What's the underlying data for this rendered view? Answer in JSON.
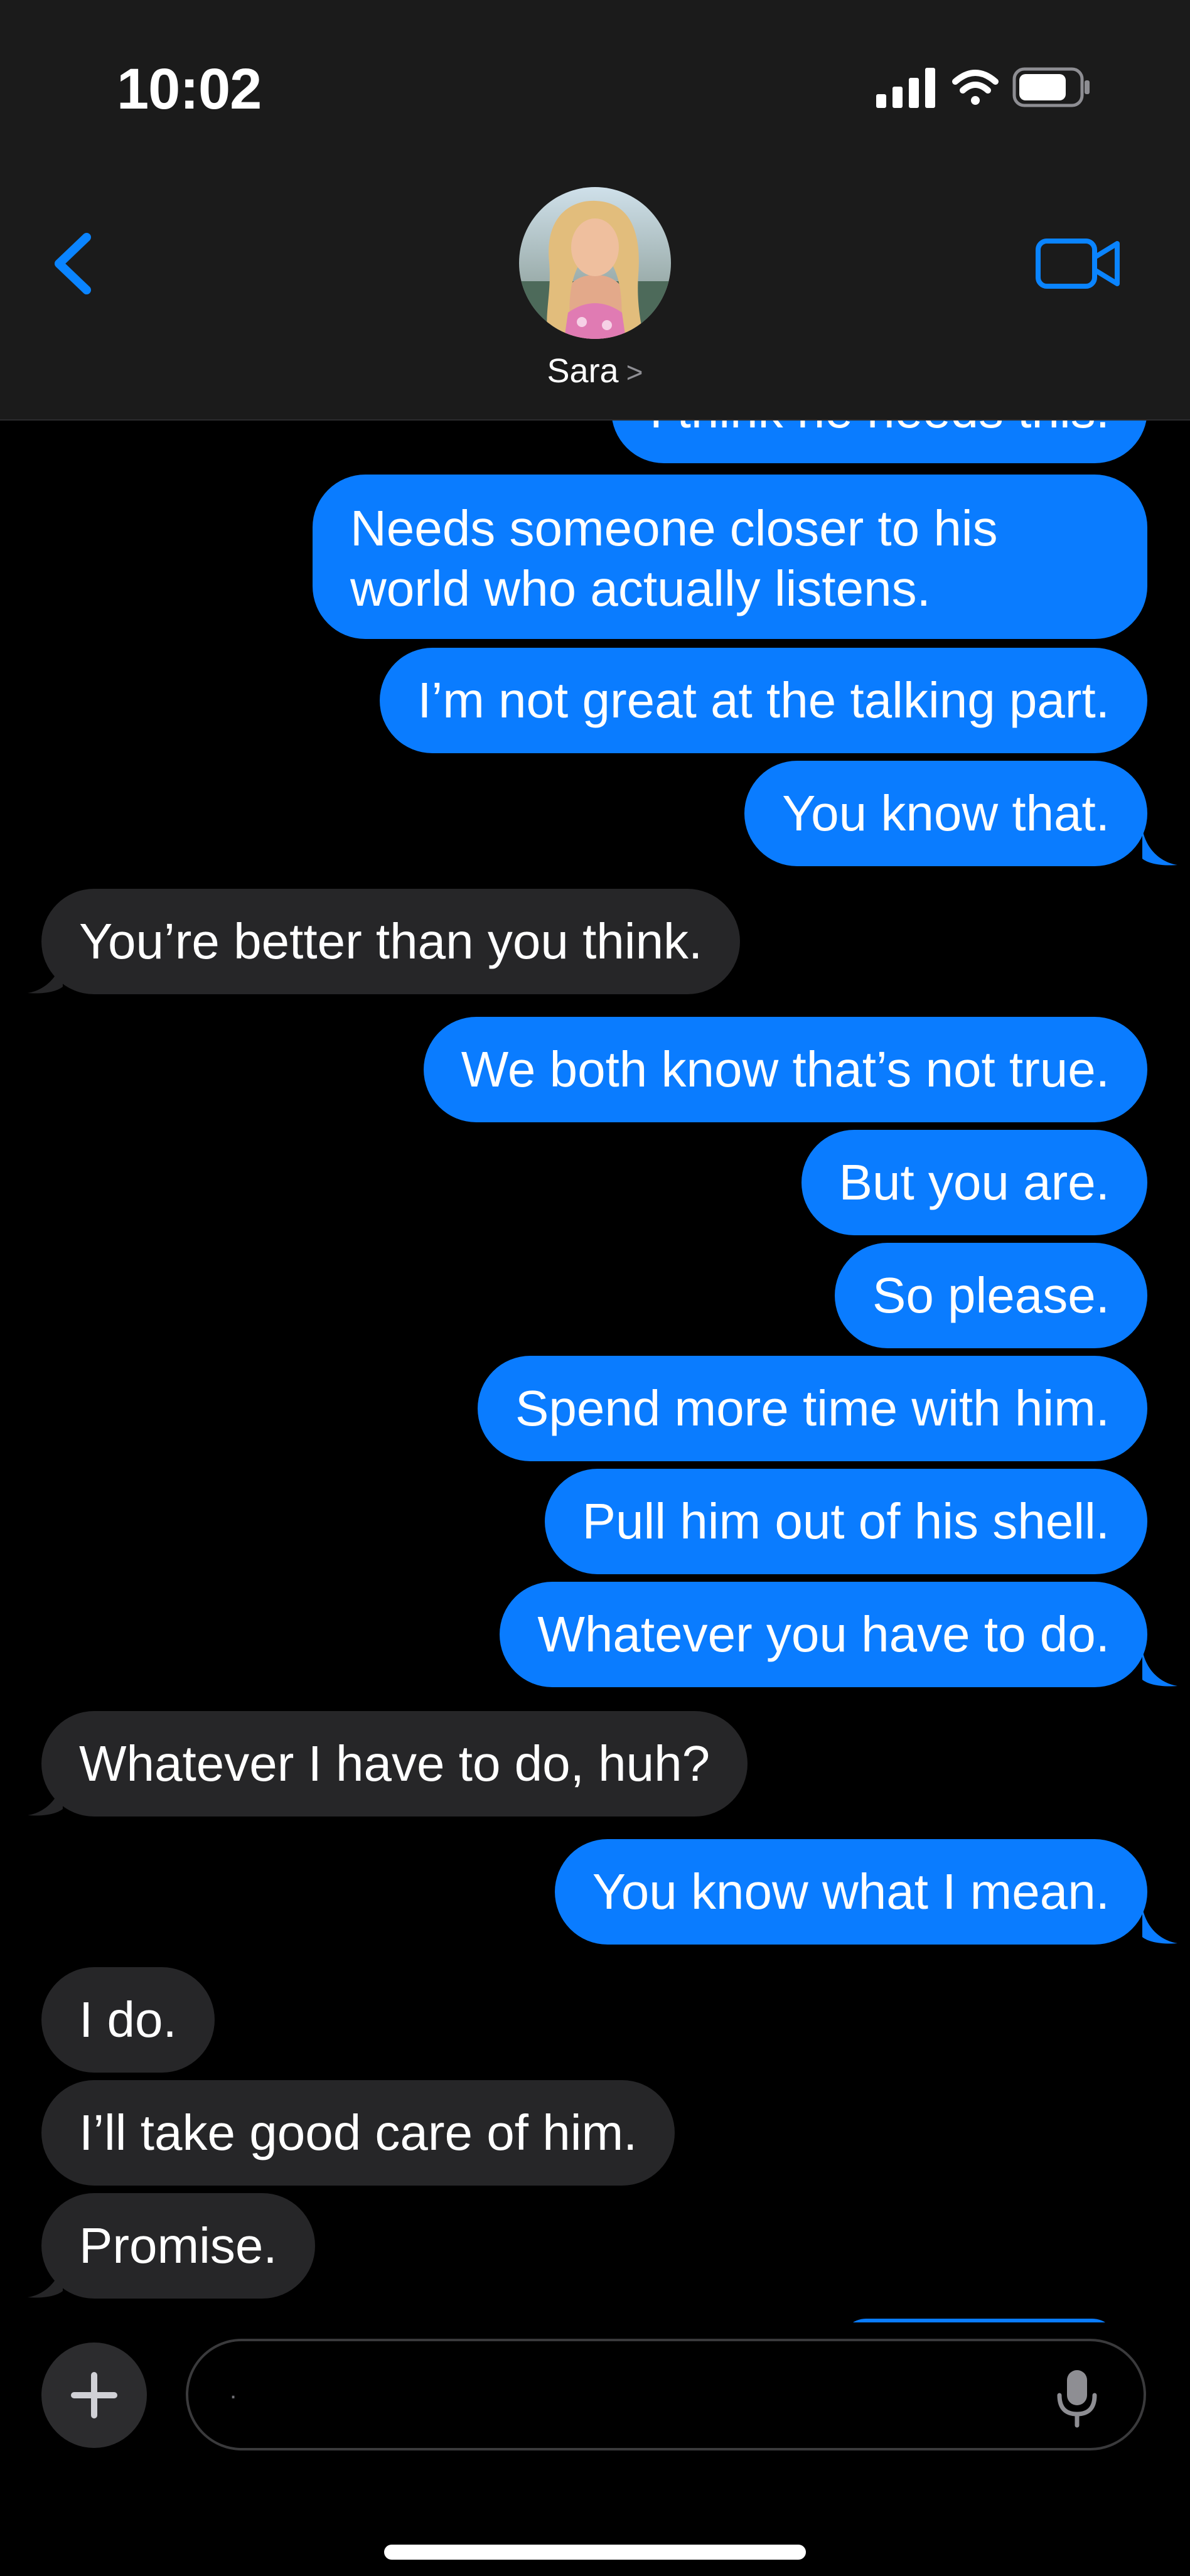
{
  "status_bar": {
    "time": "10:02",
    "signal_icon": "cellular-signal-icon",
    "wifi_icon": "wifi-icon",
    "battery_icon": "battery-icon"
  },
  "header": {
    "back_icon": "chevron-left-icon",
    "video_icon": "video-camera-icon",
    "contact_name": "Sara",
    "contact_chevron": ">"
  },
  "colors": {
    "sent_bubble": "#0a7cff",
    "received_bubble": "#262628",
    "header_bg": "#1b1b1b",
    "accent": "#0a84ff"
  },
  "messages": [
    {
      "side": "sent",
      "text": "I think he needs this."
    },
    {
      "side": "sent",
      "text": "Needs someone closer to his world who actually listens."
    },
    {
      "side": "sent",
      "text": "I’m not great at the talking part."
    },
    {
      "side": "sent",
      "text": "You know that."
    },
    {
      "side": "received",
      "text": "You’re better than you think."
    },
    {
      "side": "sent",
      "text": "We both know that’s not true."
    },
    {
      "side": "sent",
      "text": "But you are."
    },
    {
      "side": "sent",
      "text": "So please."
    },
    {
      "side": "sent",
      "text": "Spend more time with him."
    },
    {
      "side": "sent",
      "text": "Pull him out of his shell."
    },
    {
      "side": "sent",
      "text": "Whatever you have to do."
    },
    {
      "side": "received",
      "text": "Whatever I have to do, huh?"
    },
    {
      "side": "sent",
      "text": "You know what I mean."
    },
    {
      "side": "received",
      "text": "I do."
    },
    {
      "side": "received",
      "text": "I’ll take good care of him."
    },
    {
      "side": "received",
      "text": "Promise."
    }
  ],
  "composer": {
    "plus_icon": "plus-icon",
    "placeholder": ".",
    "mic_icon": "microphone-icon"
  }
}
